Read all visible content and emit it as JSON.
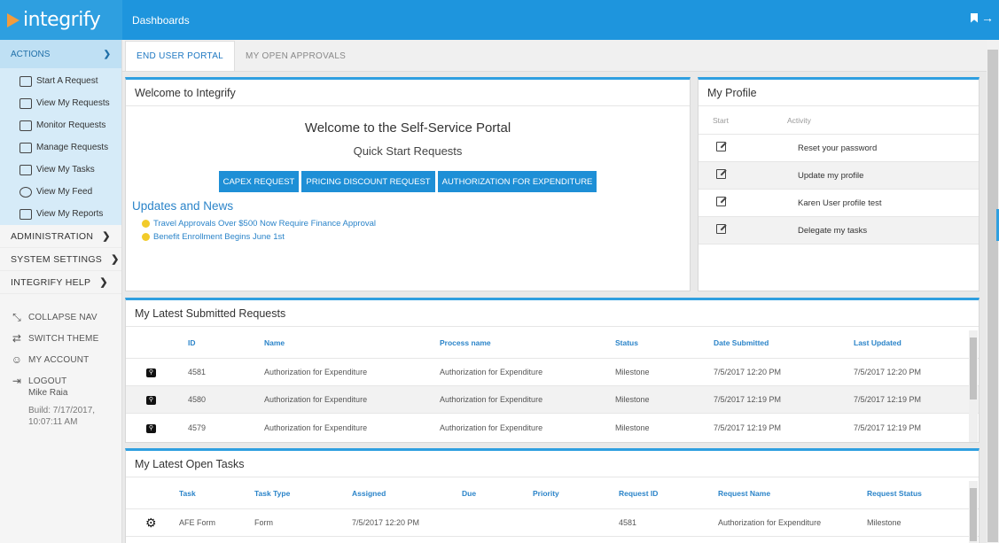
{
  "app": {
    "logo": "integrify",
    "page_title": "Dashboards",
    "accent": "#1e95dd"
  },
  "sidebar": {
    "actions_label": "ACTIONS",
    "actions": [
      {
        "label": "Start A Request",
        "icon": "new-request-icon"
      },
      {
        "label": "View My Requests",
        "icon": "requests-icon"
      },
      {
        "label": "Monitor Requests",
        "icon": "monitor-icon"
      },
      {
        "label": "Manage Requests",
        "icon": "manage-icon"
      },
      {
        "label": "View My Tasks",
        "icon": "tasks-icon"
      },
      {
        "label": "View My Feed",
        "icon": "feed-icon"
      },
      {
        "label": "View My Reports",
        "icon": "reports-icon"
      }
    ],
    "sections": [
      "ADMINISTRATION",
      "SYSTEM SETTINGS",
      "INTEGRIFY HELP"
    ],
    "utilities": [
      {
        "label": "COLLAPSE NAV",
        "icon": "collapse-icon"
      },
      {
        "label": "SWITCH THEME",
        "icon": "theme-icon"
      },
      {
        "label": "MY ACCOUNT",
        "icon": "account-icon"
      },
      {
        "label": "LOGOUT",
        "icon": "logout-icon"
      }
    ],
    "user_name": "Mike Raia",
    "build": "Build: 7/17/2017, 10:07:11 AM"
  },
  "tabs": [
    {
      "label": "END USER PORTAL",
      "active": true
    },
    {
      "label": "MY OPEN APPROVALS",
      "active": false
    }
  ],
  "welcome": {
    "title": "Welcome to Integrify",
    "heading": "Welcome to the Self-Service Portal",
    "subheading": "Quick Start Requests",
    "buttons": [
      "CAPEX REQUEST",
      "PRICING DISCOUNT REQUEST",
      "AUTHORIZATION FOR EXPENDITURE"
    ],
    "updates_title": "Updates and News",
    "news": [
      "Travel Approvals Over $500 Now Require Finance Approval",
      "Benefit Enrollment Begins June 1st"
    ]
  },
  "profile": {
    "title": "My Profile",
    "col_start": "Start",
    "col_activity": "Activity",
    "rows": [
      "Reset your password",
      "Update my profile",
      "Karen User profile test",
      "Delegate my tasks"
    ]
  },
  "submitted": {
    "title": "My Latest Submitted Requests",
    "columns": [
      "ID",
      "Name",
      "Process name",
      "Status",
      "Date Submitted",
      "Last Updated"
    ],
    "rows": [
      [
        "4581",
        "Authorization for Expenditure",
        "Authorization for Expenditure",
        "Milestone",
        "7/5/2017 12:20 PM",
        "7/5/2017 12:20 PM"
      ],
      [
        "4580",
        "Authorization for Expenditure",
        "Authorization for Expenditure",
        "Milestone",
        "7/5/2017 12:19 PM",
        "7/5/2017 12:19 PM"
      ],
      [
        "4579",
        "Authorization for Expenditure",
        "Authorization for Expenditure",
        "Milestone",
        "7/5/2017 12:19 PM",
        "7/5/2017 12:19 PM"
      ]
    ]
  },
  "tasks": {
    "title": "My Latest Open Tasks",
    "columns": [
      "Task",
      "Task Type",
      "Assigned",
      "Due",
      "Priority",
      "Request ID",
      "Request Name",
      "Request Status"
    ],
    "rows": [
      [
        "AFE Form",
        "Form",
        "7/5/2017 12:20 PM",
        "",
        "",
        "4581",
        "Authorization for Expenditure",
        "Milestone"
      ]
    ]
  }
}
